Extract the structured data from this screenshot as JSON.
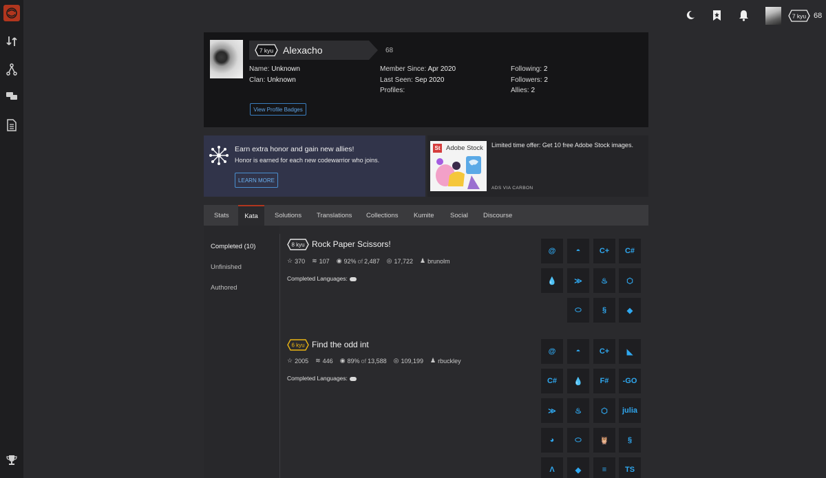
{
  "topbar": {
    "rank": "7 kyu",
    "honor": "68"
  },
  "profile": {
    "rank": "7 kyu",
    "username": "Alexacho",
    "honor": "68",
    "name_label": "Name:",
    "name_value": "Unknown",
    "clan_label": "Clan:",
    "clan_value": "Unknown",
    "member_since_label": "Member Since:",
    "member_since_value": "Apr 2020",
    "last_seen_label": "Last Seen:",
    "last_seen_value": "Sep 2020",
    "profiles_label": "Profiles:",
    "following_label": "Following:",
    "following_value": "2",
    "followers_label": "Followers:",
    "followers_value": "2",
    "allies_label": "Allies:",
    "allies_value": "2",
    "badges_button": "View Profile Badges"
  },
  "promo": {
    "title": "Earn extra honor and gain new allies!",
    "subtitle": "Honor is earned for each new codewarrior who joins.",
    "button": "LEARN MORE"
  },
  "ad": {
    "logo_text": "St",
    "brand": "Adobe Stock",
    "text": "Limited time offer: Get 10 free Adobe Stock images.",
    "via": "ADS VIA CARBON"
  },
  "tabs": [
    "Stats",
    "Kata",
    "Solutions",
    "Translations",
    "Collections",
    "Kumite",
    "Social",
    "Discourse"
  ],
  "leftnav": [
    "Completed (10)",
    "Unfinished",
    "Authored"
  ],
  "katas": [
    {
      "rank": "8 kyu",
      "rank_color": "#e6e6e6",
      "title": "Rock Paper Scissors!",
      "stars": "370",
      "collections": "107",
      "satisfaction": "92%",
      "of_label": "of",
      "votes": "2,487",
      "completed": "17,722",
      "author": "brunolm",
      "langs_label": "Completed Languages:",
      "languages": [
        "coffeescript-icon",
        "crystal-icon",
        "cpp-icon",
        "csharp-icon",
        "elixir-icon",
        "haskell-icon",
        "java-icon",
        "javascript-icon",
        "ocaml-icon",
        "python-icon",
        "ruby-icon"
      ]
    },
    {
      "rank": "6 kyu",
      "rank_color": "#ecb613",
      "title": "Find the odd int",
      "stars": "2005",
      "collections": "446",
      "satisfaction": "89%",
      "of_label": "of",
      "votes": "13,588",
      "completed": "109,199",
      "author": "rbuckley",
      "langs_label": "Completed Languages:",
      "languages": [
        "coffeescript-icon",
        "crystal-icon",
        "cpp-icon",
        "dart-icon",
        "csharp-icon",
        "elixir-icon",
        "fsharp-icon",
        "go-icon",
        "haskell-icon",
        "java-icon",
        "javascript-icon",
        "julia-icon",
        "nim-icon",
        "ocaml-icon",
        "php-icon",
        "python-icon",
        "reason-icon",
        "ruby-icon",
        "solidity-icon",
        "typescript-icon"
      ]
    }
  ],
  "colors": {
    "accent": "#b1361e",
    "link": "#5fa5e8",
    "lang_icon": "#2fa8f0"
  }
}
